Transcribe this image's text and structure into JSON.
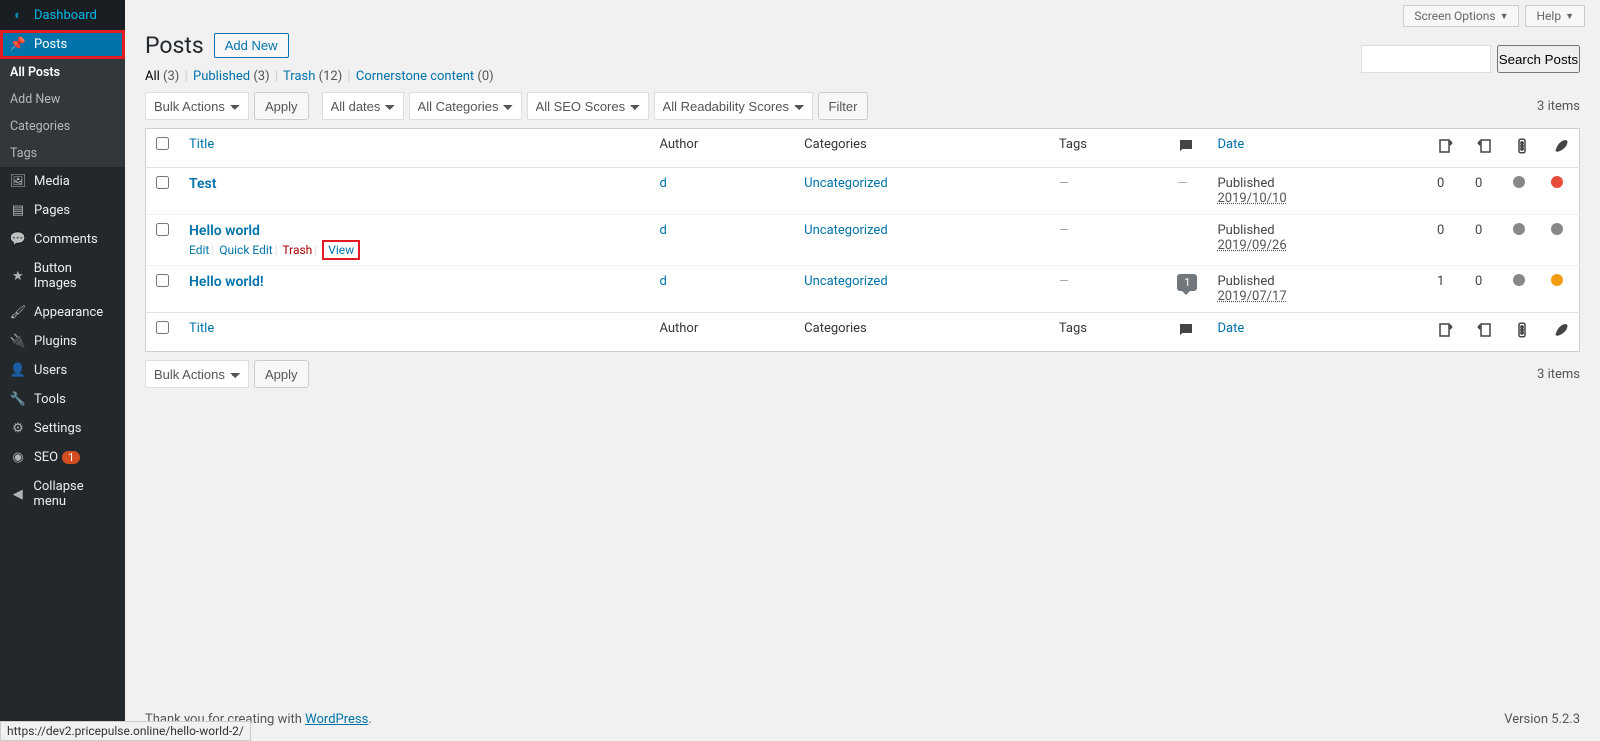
{
  "topbar": {
    "screen_options": "Screen Options",
    "help": "Help"
  },
  "sidebar": {
    "items": [
      {
        "label": "Dashboard"
      },
      {
        "label": "Posts"
      },
      {
        "label": "Media"
      },
      {
        "label": "Pages"
      },
      {
        "label": "Comments"
      },
      {
        "label": "Button Images"
      },
      {
        "label": "Appearance"
      },
      {
        "label": "Plugins"
      },
      {
        "label": "Users"
      },
      {
        "label": "Tools"
      },
      {
        "label": "Settings"
      },
      {
        "label": "SEO",
        "badge": "1"
      },
      {
        "label": "Collapse menu"
      }
    ],
    "submenu": [
      {
        "label": "All Posts"
      },
      {
        "label": "Add New"
      },
      {
        "label": "Categories"
      },
      {
        "label": "Tags"
      }
    ]
  },
  "header": {
    "title": "Posts",
    "add_new": "Add New"
  },
  "filters": {
    "links": [
      {
        "label": "All",
        "count": "(3)"
      },
      {
        "label": "Published",
        "count": "(3)"
      },
      {
        "label": "Trash",
        "count": "(12)"
      },
      {
        "label": "Cornerstone content",
        "count": "(0)"
      }
    ]
  },
  "search": {
    "button": "Search Posts"
  },
  "bulk": {
    "bulk_actions": "Bulk Actions",
    "apply": "Apply",
    "all_dates": "All dates",
    "all_categories": "All Categories",
    "all_seo": "All SEO Scores",
    "all_read": "All Readability Scores",
    "filter": "Filter"
  },
  "count_text": "3 items",
  "columns": {
    "title": "Title",
    "author": "Author",
    "categories": "Categories",
    "tags": "Tags",
    "date": "Date"
  },
  "row_actions": {
    "edit": "Edit",
    "quick_edit": "Quick Edit",
    "trash": "Trash",
    "view": "View"
  },
  "rows": [
    {
      "title": "Test",
      "author": "d",
      "category": "Uncategorized",
      "tags": "—",
      "comments": "—",
      "date_status": "Published",
      "date": "2019/10/10",
      "c1": "0",
      "c2": "0",
      "seo": "gray",
      "read": "red"
    },
    {
      "title": "Hello world",
      "author": "d",
      "category": "Uncategorized",
      "tags": "—",
      "comments": "",
      "date_status": "Published",
      "date": "2019/09/26",
      "c1": "0",
      "c2": "0",
      "seo": "gray",
      "read": "gray",
      "show_actions": true
    },
    {
      "title": "Hello world!",
      "author": "d",
      "category": "Uncategorized",
      "tags": "—",
      "comments": "1",
      "date_status": "Published",
      "date": "2019/07/17",
      "c1": "1",
      "c2": "0",
      "seo": "gray",
      "read": "orange"
    }
  ],
  "footer": {
    "thankyou": "Thank you for creating with ",
    "wp": "WordPress",
    "version": "Version 5.2.3"
  },
  "status_url": "https://dev2.pricepulse.online/hello-world-2/"
}
